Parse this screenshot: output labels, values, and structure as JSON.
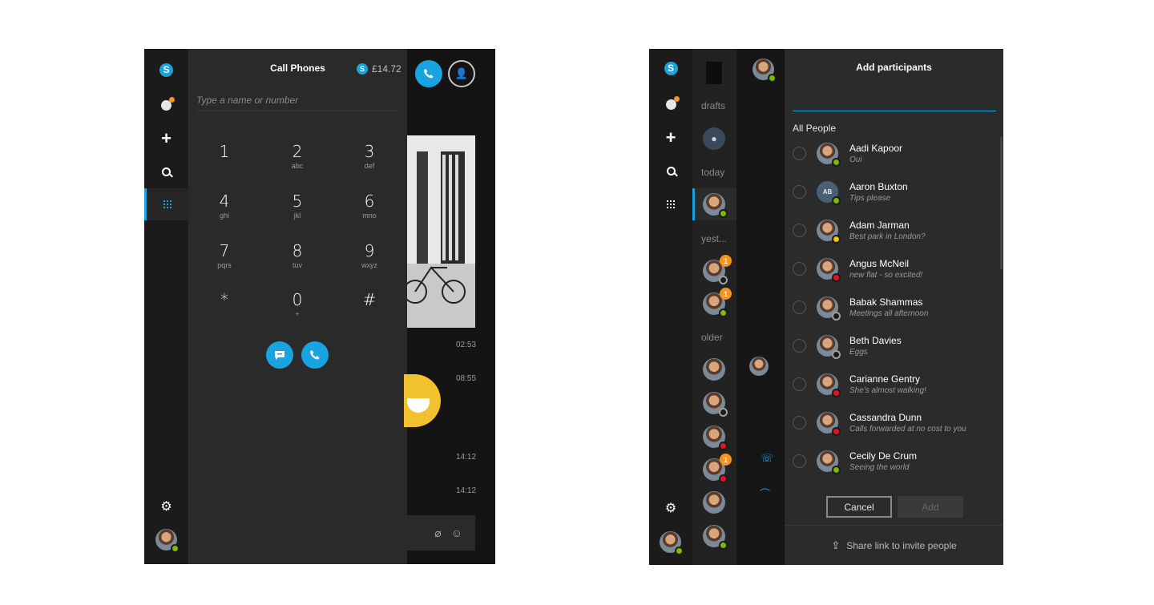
{
  "left_window": {
    "dialer": {
      "title": "Call Phones",
      "credit": "£14.72",
      "input_placeholder": "Type a name or number",
      "keys": [
        {
          "digit": "1",
          "letters": ""
        },
        {
          "digit": "2",
          "letters": "abc"
        },
        {
          "digit": "3",
          "letters": "def"
        },
        {
          "digit": "4",
          "letters": "ghi"
        },
        {
          "digit": "5",
          "letters": "jkl"
        },
        {
          "digit": "6",
          "letters": "mno"
        },
        {
          "digit": "7",
          "letters": "pqrs"
        },
        {
          "digit": "8",
          "letters": "tuv"
        },
        {
          "digit": "9",
          "letters": "wxyz"
        },
        {
          "digit": "*",
          "letters": ""
        },
        {
          "digit": "0",
          "letters": "+"
        },
        {
          "digit": "#",
          "letters": ""
        }
      ]
    },
    "conversation": {
      "timestamps": [
        "02:53",
        "08:55",
        "14:12",
        "14:12"
      ]
    }
  },
  "right_window": {
    "recents": {
      "labels": [
        "drafts",
        "today",
        "yest...",
        "older"
      ],
      "badges": [
        "1",
        "1",
        "1"
      ]
    },
    "add_participants": {
      "title": "Add participants",
      "section": "All People",
      "people": [
        {
          "name": "Aadi Kapoor",
          "status": "Oui",
          "presence": "green",
          "initials": ""
        },
        {
          "name": "Aaron Buxton",
          "status": "Tips please",
          "presence": "green",
          "initials": "AB"
        },
        {
          "name": "Adam Jarman",
          "status": "Best park in London?",
          "presence": "yellow",
          "initials": ""
        },
        {
          "name": "Angus McNeil",
          "status": "new flat - so excited!",
          "presence": "red",
          "initials": ""
        },
        {
          "name": "Babak Shammas",
          "status": "Meetings all afternoon",
          "presence": "gray",
          "initials": ""
        },
        {
          "name": "Beth Davies",
          "status": "Eggs",
          "presence": "gray",
          "initials": ""
        },
        {
          "name": "Carianne Gentry",
          "status": "She's almost walking!",
          "presence": "red",
          "initials": ""
        },
        {
          "name": "Cassandra Dunn",
          "status": "Calls forwarded at no cost to you",
          "presence": "red",
          "initials": ""
        },
        {
          "name": "Cecily De Crum",
          "status": "Seeing the world",
          "presence": "green",
          "initials": ""
        }
      ],
      "cancel_label": "Cancel",
      "add_label": "Add",
      "share_label": "Share link to invite people"
    }
  },
  "colors": {
    "accent": "#19a3e0",
    "presence_online": "#7fba00",
    "presence_busy": "#e81123",
    "presence_away": "#f8c300",
    "badge": "#f7931e"
  }
}
